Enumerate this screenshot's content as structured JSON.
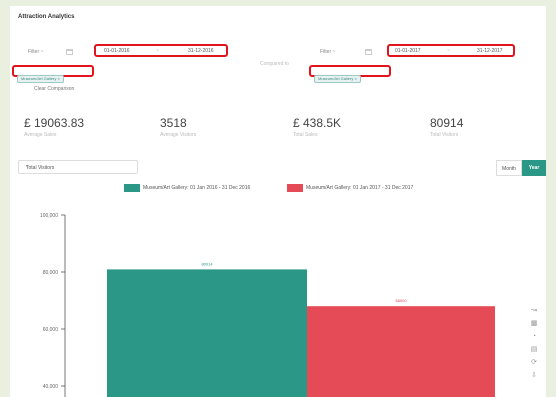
{
  "page": {
    "title": "Attraction Analytics"
  },
  "filters": {
    "left": {
      "label": "Filter ~",
      "date_from": "01-01-2016",
      "date_separator": "~",
      "date_to": "31-12-2016",
      "tag": "Museum/Art Gallery",
      "tag_remove": "×"
    },
    "compared_to": "Compared to",
    "right": {
      "label": "Filter ~",
      "date_from": "01-01-2017",
      "date_separator": "~",
      "date_to": "31-12-2017",
      "tag": "Museum/Art Gallery",
      "tag_remove": "×"
    },
    "clear": "Clear Comparison"
  },
  "stats": [
    {
      "value": "£ 19063.83",
      "label": "Average Sales"
    },
    {
      "value": "3518",
      "label": "Average Visitors"
    },
    {
      "value": "£ 438.5K",
      "label": "Total Sales"
    },
    {
      "value": "80914",
      "label": "Total Visitors"
    }
  ],
  "controls": {
    "metric_select": "Total Visitors",
    "month_label": "Month",
    "year_label": "Year"
  },
  "colors": {
    "series_a": "#2a9787",
    "series_b": "#e54b57",
    "accent": "#2a9787",
    "highlight": "#e1141e"
  },
  "side_icons": [
    "line-chart-icon",
    "bar-chart-icon",
    "pie-chart-icon",
    "data-view-icon",
    "restore-icon",
    "save-image-icon"
  ],
  "chart_data": {
    "type": "bar",
    "categories": [
      ""
    ],
    "series": [
      {
        "name": "Museum/Art Gallery: 01 Jan 2016 - 31 Dec 2016",
        "values": [
          80914
        ],
        "label": "80914"
      },
      {
        "name": "Museum/Art Gallery: 01 Jan 2017 - 31 Dec 2017",
        "values": [
          68000
        ],
        "label": "68000"
      }
    ],
    "ylim": [
      30000,
      100000
    ],
    "yticks": [
      "100,000",
      "80,000",
      "60,000",
      "40,000"
    ],
    "grid": false,
    "legend": "top"
  }
}
